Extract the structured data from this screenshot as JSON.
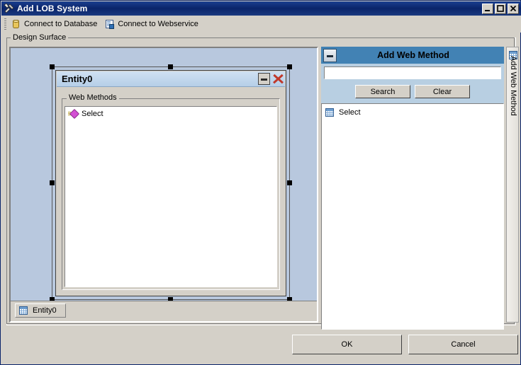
{
  "window": {
    "title": "Add LOB System",
    "icon": "tools-icon",
    "controls": [
      {
        "name": "minimize-button",
        "glyph": "_"
      },
      {
        "name": "maximize-button",
        "glyph": "□"
      },
      {
        "name": "close-button",
        "glyph": "✕"
      }
    ]
  },
  "toolbar": {
    "items": [
      {
        "label": "Connect to Database",
        "icon": "database-icon"
      },
      {
        "label": "Connect to Webservice",
        "icon": "webservice-icon"
      }
    ]
  },
  "design_surface": {
    "label": "Design Surface",
    "entity": {
      "title": "Entity0",
      "minimize_label": "minimize",
      "close_label": "close",
      "group_label": "Web Methods",
      "methods": [
        {
          "label": "Select",
          "icon": "method-icon"
        }
      ]
    },
    "tabs": [
      {
        "label": "Entity0",
        "icon": "table-icon"
      }
    ]
  },
  "add_web_method": {
    "title": "Add Web Method",
    "collapse_label": "collapse",
    "search_value": "",
    "search_placeholder": "",
    "buttons": {
      "search": "Search",
      "clear": "Clear"
    },
    "results": [
      {
        "label": "Select",
        "icon": "table-icon"
      }
    ],
    "vertical_tab": {
      "label": "Add Web Method",
      "icon": "table-icon"
    }
  },
  "footer": {
    "ok": "OK",
    "cancel": "Cancel"
  },
  "colors": {
    "titlebar": "#0a246a",
    "panel_header": "#4282b4",
    "canvas": "#b8c8de",
    "search_bg": "#b8cfe2",
    "chrome": "#d4d0c8",
    "entity_title": "#b6cfe8",
    "close_x": "#c0392b",
    "method_diamond": "#d34fd3"
  }
}
